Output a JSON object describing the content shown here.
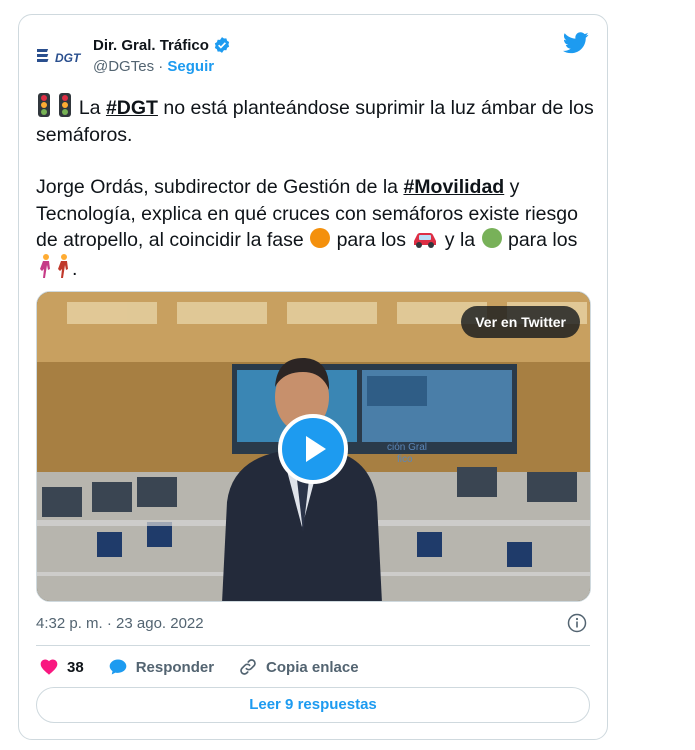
{
  "author": {
    "name": "Dir. Gral. Tráfico",
    "handle": "@DGTes",
    "separator": "·",
    "follow_label": "Seguir",
    "logo_text": "DGT"
  },
  "tweet": {
    "line1_pre": " La ",
    "hashtag1": "#DGT",
    "line1_post": " no está planteándose suprimir la luz ámbar de los semáforos.",
    "p2_pre": "Jorge Ordás, subdirector de Gestión de la ",
    "hashtag2": "#Movilidad",
    "p2_mid": " y Tecnología, explica en qué cruces con semáforos existe riesgo de atropello, al coincidir la fase ",
    "p2_mid2": " para los ",
    "p2_mid3": " y la ",
    "p2_mid4": " para los ",
    "p2_end": "."
  },
  "media": {
    "view_on_twitter": "Ver en Twitter",
    "wall_text_1": "ción Gral",
    "wall_text_2": "fico"
  },
  "meta": {
    "timestamp": "4:32 p. m. · 23 ago. 2022"
  },
  "actions": {
    "likes": "38",
    "reply_label": "Responder",
    "copy_label": "Copia enlace",
    "read_replies": "Leer 9 respuestas"
  },
  "colors": {
    "accent": "#1d9bf0",
    "like": "#f91880",
    "text": "#0f1419",
    "secondary": "#536471",
    "border": "#cfd9de"
  },
  "icons": [
    "dgt-logo-icon",
    "verified-badge-icon",
    "twitter-bird-icon",
    "traffic-light-icon",
    "orange-circle-icon",
    "car-icon",
    "green-circle-icon",
    "pedestrian-icon",
    "play-icon",
    "info-icon",
    "heart-icon",
    "reply-bubble-icon",
    "link-icon"
  ]
}
